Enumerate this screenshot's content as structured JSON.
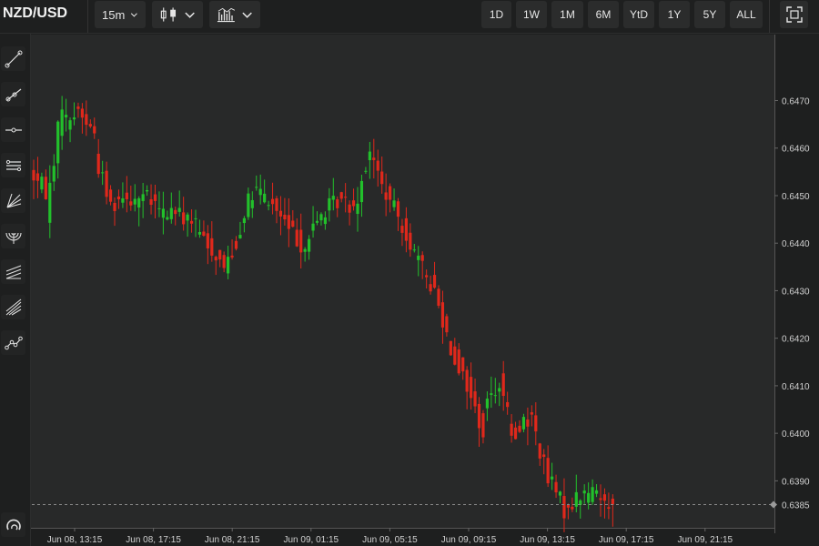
{
  "header": {
    "symbol": "NZD/USD",
    "interval": "15m",
    "chart_type_icon": "candlestick-icon",
    "indicators_icon": "indicators-icon",
    "ranges": [
      "1D",
      "1W",
      "1M",
      "6M",
      "YtD",
      "1Y",
      "5Y",
      "ALL"
    ],
    "fullscreen_icon": "fullscreen-icon"
  },
  "toolbar": {
    "tools": [
      "trend-line-icon",
      "ray-icon",
      "horizontal-line-icon",
      "parallel-channel-icon",
      "fib-fan-icon",
      "fib-arc-icon",
      "pitchfork-icon",
      "gann-fan-icon",
      "polyline-icon"
    ],
    "bottom": "magnet-icon"
  },
  "colors": {
    "up": "#22c02b",
    "down": "#e0281b",
    "background": "#282929",
    "axis_text": "#d0d0d0"
  },
  "chart_data": {
    "type": "candlestick",
    "interval": "15m",
    "x_tick_labels": [
      "Jun 08, 13:15",
      "Jun 08, 17:15",
      "Jun 08, 21:15",
      "Jun 09, 01:15",
      "Jun 09, 05:15",
      "Jun 09, 09:15",
      "Jun 09, 13:15",
      "Jun 09, 17:15",
      "Jun 09, 21:15"
    ],
    "y_ticks": [
      0.639,
      0.64,
      0.641,
      0.642,
      0.643,
      0.644,
      0.645,
      0.646,
      0.647
    ],
    "ylim": [
      0.63805,
      0.64835
    ],
    "last_price": 0.6385,
    "last_price_label": "0.6385",
    "grid": false,
    "ohlc_anchor_values": [
      [
        0.6455,
        0.6451
      ],
      [
        0.6446,
        0.647
      ],
      [
        0.6465,
        0.6468
      ],
      [
        0.6468,
        0.6463
      ],
      [
        0.6459,
        0.6448
      ],
      [
        0.6448,
        0.6451
      ],
      [
        0.6449,
        0.645
      ],
      [
        0.645,
        0.6447
      ],
      [
        0.6446,
        0.6447
      ],
      [
        0.6446,
        0.6445
      ],
      [
        0.6445,
        0.6439
      ],
      [
        0.644,
        0.6435
      ],
      [
        0.6435,
        0.6442
      ],
      [
        0.6446,
        0.6451
      ],
      [
        0.6451,
        0.6448
      ],
      [
        0.6448,
        0.6443
      ],
      [
        0.6443,
        0.6439
      ],
      [
        0.644,
        0.6446
      ],
      [
        0.6446,
        0.6449
      ],
      [
        0.6449,
        0.6448
      ],
      [
        0.6447,
        0.646
      ],
      [
        0.6459,
        0.645
      ],
      [
        0.645,
        0.6444
      ],
      [
        0.6444,
        0.6436
      ],
      [
        0.6436,
        0.643
      ],
      [
        0.643,
        0.6418
      ],
      [
        0.6418,
        0.641
      ],
      [
        0.641,
        0.64
      ],
      [
        0.6405,
        0.6411
      ],
      [
        0.6411,
        0.6397
      ],
      [
        0.6402,
        0.6403
      ],
      [
        0.6403,
        0.639
      ],
      [
        0.6391,
        0.6384
      ],
      [
        0.6384,
        0.6387
      ],
      [
        0.6387,
        0.6388
      ],
      [
        0.6387,
        0.6385
      ]
    ]
  }
}
